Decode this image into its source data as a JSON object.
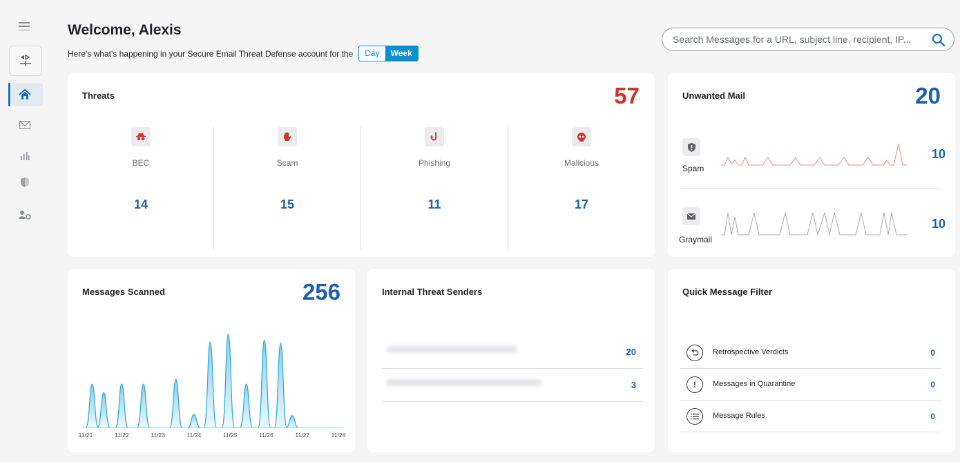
{
  "header": {
    "welcome": "Welcome, Alexis",
    "subline": "Here's what's happening in your Secure Email Threat Defense account for the",
    "period_options": [
      "Day",
      "Week"
    ],
    "period_selected": "Week"
  },
  "search": {
    "placeholder": "Search Messages for a URL, subject line, recipient, IP..."
  },
  "sidebar": {
    "items": [
      {
        "icon": "menu-icon"
      },
      {
        "icon": "app-switcher-icon"
      },
      {
        "icon": "home-icon",
        "active": true
      },
      {
        "icon": "mail-icon"
      },
      {
        "icon": "bar-chart-icon"
      },
      {
        "icon": "shield-icon"
      },
      {
        "icon": "user-settings-icon"
      }
    ]
  },
  "threats": {
    "title": "Threats",
    "total": "57",
    "categories": [
      {
        "label": "BEC",
        "value": "14",
        "icon": "spy-icon"
      },
      {
        "label": "Scam",
        "value": "15",
        "icon": "hand-icon"
      },
      {
        "label": "Phishing",
        "value": "11",
        "icon": "fishhook-icon"
      },
      {
        "label": "Malicious",
        "value": "17",
        "icon": "skull-icon"
      }
    ]
  },
  "unwanted": {
    "title": "Unwanted Mail",
    "total": "20",
    "rows": [
      {
        "label": "Spam",
        "value": "10",
        "icon": "shield-alert-icon",
        "color": "#f08a8a"
      },
      {
        "label": "Graymail",
        "value": "10",
        "icon": "envelope-icon",
        "color": "#a8acb1"
      }
    ]
  },
  "scanned": {
    "title": "Messages Scanned",
    "total": "256"
  },
  "chart_data": {
    "type": "area",
    "x_ticks": [
      "11/21",
      "11/22",
      "11/23",
      "11/24",
      "11/25",
      "11/26",
      "11/27",
      "11/28"
    ],
    "peaks": [
      {
        "x": 0.18,
        "y": 66
      },
      {
        "x": 0.5,
        "y": 53
      },
      {
        "x": 1.0,
        "y": 66
      },
      {
        "x": 1.6,
        "y": 66
      },
      {
        "x": 2.5,
        "y": 73
      },
      {
        "x": 3.0,
        "y": 20
      },
      {
        "x": 3.45,
        "y": 130
      },
      {
        "x": 3.95,
        "y": 142
      },
      {
        "x": 4.45,
        "y": 66
      },
      {
        "x": 4.95,
        "y": 133
      },
      {
        "x": 5.4,
        "y": 128
      },
      {
        "x": 5.72,
        "y": 18
      }
    ],
    "color": "#2aa7df"
  },
  "internal": {
    "title": "Internal Threat Senders",
    "rows": [
      {
        "value": "20"
      },
      {
        "value": "3"
      }
    ]
  },
  "quick": {
    "title": "Quick Message Filter",
    "rows": [
      {
        "label": "Retrospective Verdicts",
        "value": "0",
        "icon": "undo-icon"
      },
      {
        "label": "Messages in Quarantine",
        "value": "0",
        "icon": "alert-icon"
      },
      {
        "label": "Message Rules",
        "value": "0",
        "icon": "list-icon"
      }
    ]
  },
  "colors": {
    "accent": "#0a8fd1",
    "threat_total": "#d0342c",
    "value_blue": "#1d5fb4"
  }
}
